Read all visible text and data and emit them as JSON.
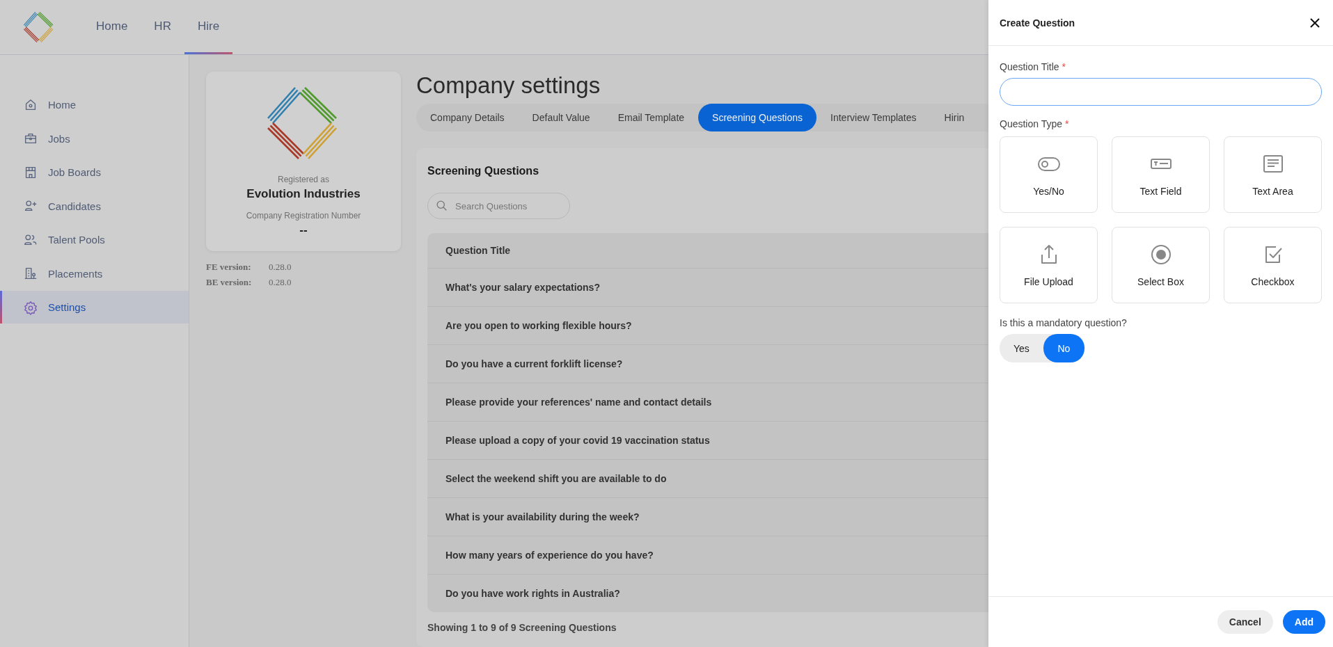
{
  "header": {
    "nav": [
      {
        "label": "Home",
        "selected": false
      },
      {
        "label": "HR",
        "selected": false
      },
      {
        "label": "Hire",
        "selected": true
      }
    ]
  },
  "sidebar": {
    "items": [
      {
        "label": "Home",
        "kind": "home",
        "selected": false
      },
      {
        "label": "Jobs",
        "kind": "jobs",
        "selected": false
      },
      {
        "label": "Job Boards",
        "kind": "boards",
        "selected": false
      },
      {
        "label": "Candidates",
        "kind": "candidates",
        "selected": false
      },
      {
        "label": "Talent Pools",
        "kind": "pools",
        "selected": false
      },
      {
        "label": "Placements",
        "kind": "placements",
        "selected": false
      },
      {
        "label": "Settings",
        "kind": "settings",
        "selected": true
      }
    ]
  },
  "company_card": {
    "registered_label": "Registered as",
    "name": "Evolution Industries",
    "registration_label": "Company Registration Number",
    "registration_value": "--"
  },
  "versions": [
    {
      "label": "FE version:",
      "value": "0.28.0"
    },
    {
      "label": "BE version:",
      "value": "0.28.0"
    }
  ],
  "page_title": "Company settings",
  "tabs": [
    {
      "label": "Company Details",
      "selected": false
    },
    {
      "label": "Default Value",
      "selected": false
    },
    {
      "label": "Email Template",
      "selected": false
    },
    {
      "label": "Screening Questions",
      "selected": true
    },
    {
      "label": "Interview Templates",
      "selected": false
    },
    {
      "label": "Hirin",
      "selected": false
    }
  ],
  "panel": {
    "title": "Screening Questions",
    "search": {
      "placeholder": "Search Questions"
    },
    "table": {
      "columns": [
        "Question Title"
      ],
      "rows": [
        [
          "What's your salary expectations?"
        ],
        [
          "Are you open to working flexible hours?"
        ],
        [
          "Do you have a current forklift license?"
        ],
        [
          "Please provide your references' name and contact details"
        ],
        [
          "Please upload a copy of your covid 19 vaccination status"
        ],
        [
          "Select the weekend shift you are available to do"
        ],
        [
          "What is your availability during the week?"
        ],
        [
          "How many years of experience do you have?"
        ],
        [
          "Do you have work rights in Australia?"
        ]
      ]
    },
    "footer": "Showing 1 to 9 of 9 Screening Questions"
  },
  "drawer": {
    "title": "Create Question",
    "title_field": {
      "label": "Question Title",
      "required_mark": "*"
    },
    "type_field": {
      "label": "Question Type",
      "required_mark": "*"
    },
    "question_types": [
      {
        "label": "Yes/No",
        "kind": "yesno",
        "selected": false
      },
      {
        "label": "Text Field",
        "kind": "textfield",
        "selected": false
      },
      {
        "label": "Text Area",
        "kind": "textarea",
        "selected": false
      },
      {
        "label": "File Upload",
        "kind": "upload",
        "selected": false
      },
      {
        "label": "Select Box",
        "kind": "select",
        "selected": false
      },
      {
        "label": "Checkbox",
        "kind": "checkbox",
        "selected": false
      }
    ],
    "mandatory": {
      "label": "Is this a mandatory question?",
      "options": [
        {
          "label": "Yes",
          "selected": false
        },
        {
          "label": "No",
          "selected": true
        }
      ]
    },
    "buttons": [
      {
        "label": "Cancel",
        "kind": "secondary"
      },
      {
        "label": "Add",
        "kind": "primary"
      }
    ]
  }
}
